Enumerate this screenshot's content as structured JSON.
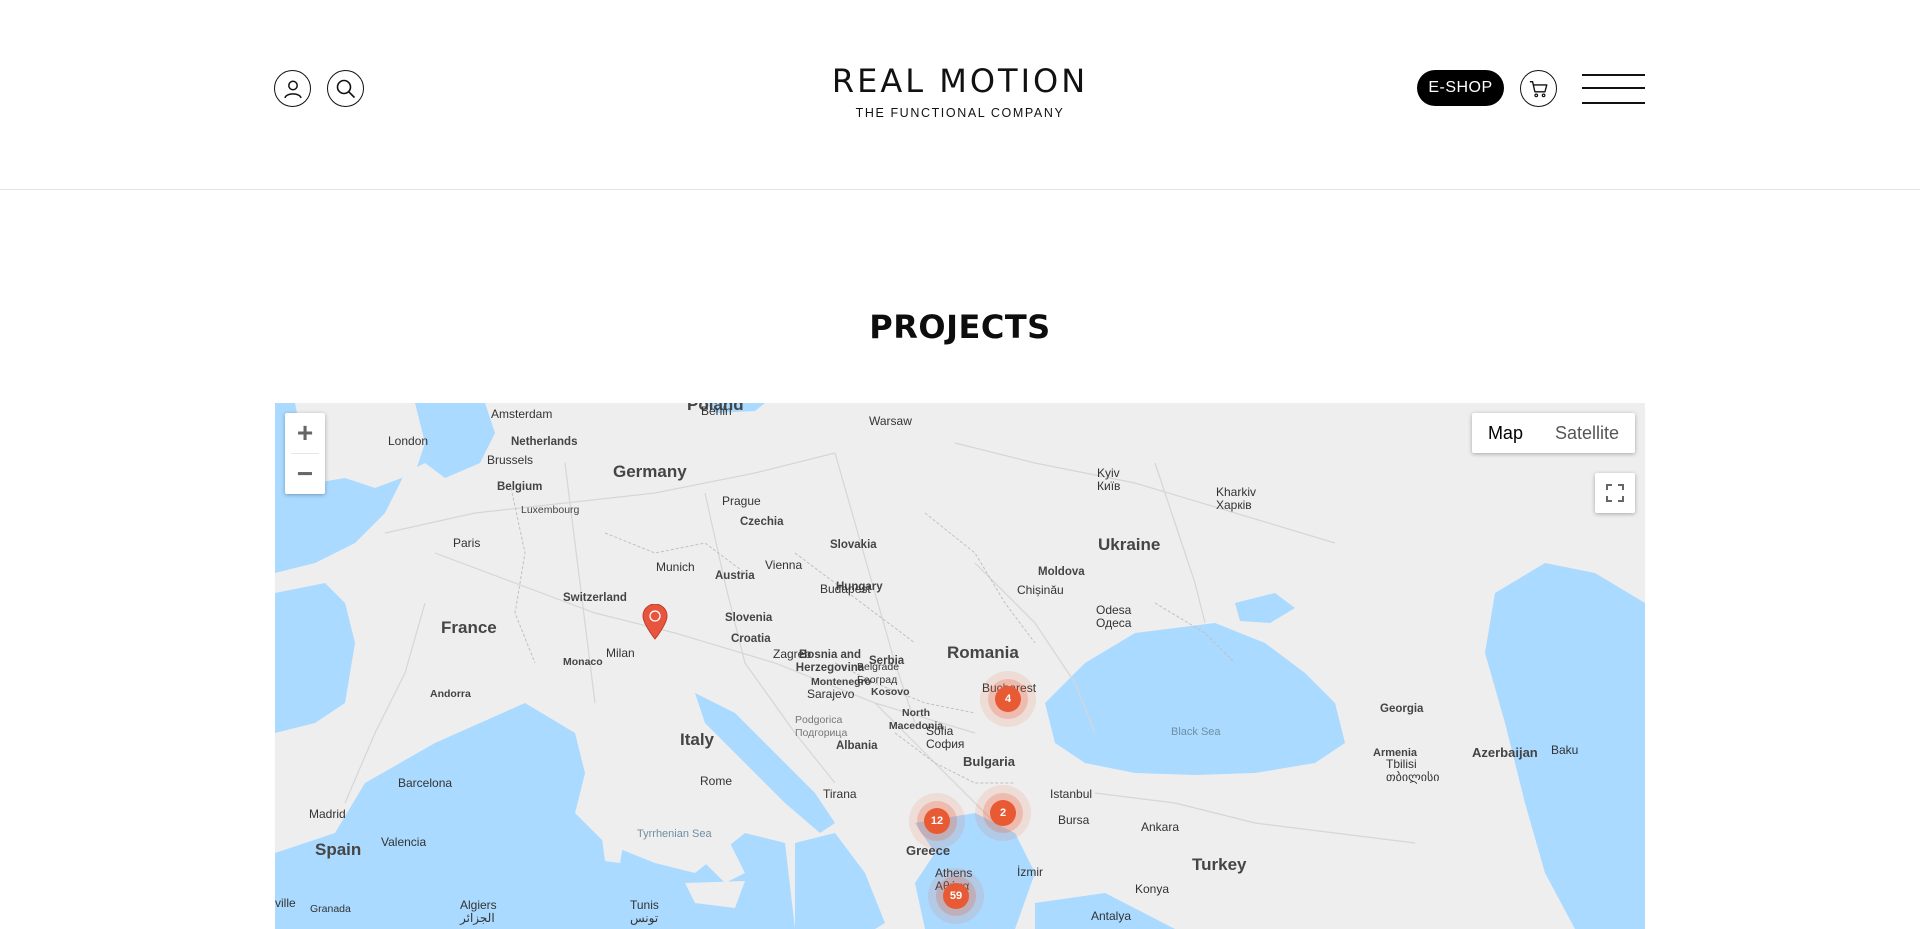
{
  "header": {
    "logo_main": "REAL MOTION",
    "logo_sub": "THE FUNCTIONAL COMPANY",
    "eshop_label": "E-SHOP"
  },
  "page": {
    "title": "PROJECTS"
  },
  "map": {
    "type_options": {
      "map": "Map",
      "satellite": "Satellite",
      "selected": "Map"
    },
    "zoom_in": "+",
    "zoom_out": "−",
    "clusters": [
      {
        "count": "4"
      },
      {
        "count": "12"
      },
      {
        "count": "2"
      },
      {
        "count": "59"
      }
    ],
    "countries": [
      "Poland",
      "Germany",
      "France",
      "Ukraine",
      "Romania",
      "Italy",
      "Spain",
      "Bulgaria",
      "Greece",
      "Turkey"
    ],
    "small_countries": [
      "Netherlands",
      "Belgium",
      "Luxembourg",
      "Czechia",
      "Slovakia",
      "Austria",
      "Hungary",
      "Moldova",
      "Switzerland",
      "Slovenia",
      "Croatia",
      "Bosnia and Herzegovina",
      "Serbia",
      "Monaco",
      "Andorra",
      "Montenegro",
      "Kosovo",
      "North Macedonia",
      "Albania",
      "Georgia",
      "Armenia",
      "Azerbaijan"
    ],
    "cities": [
      "Amsterdam",
      "London",
      "Brussels",
      "Berlin",
      "Warsaw",
      "Prague",
      "Paris",
      "Munich",
      "Vienna",
      "Budapest",
      "Kyiv Київ",
      "Kharkiv Харків",
      "Odesa Одеса",
      "Chișinău",
      "Milan",
      "Zagreb",
      "Belgrade Београд",
      "Bucharest",
      "Sarajevo",
      "Sofia София",
      "Podgorica Подгорица",
      "Rome",
      "Tirana",
      "Barcelona",
      "Madrid",
      "Valencia",
      "Istanbul",
      "Bursa",
      "Ankara",
      "İzmir",
      "Athens Αθήνα",
      "Tbilisi თბილისი",
      "Baku",
      "Konya",
      "Antalya",
      "Granada",
      "Algiers الجزائر",
      "Tunis تونس",
      "ville"
    ],
    "seas": [
      "Black Sea",
      "Tyrrhenian Sea"
    ]
  },
  "colors": {
    "accent": "#e85a34",
    "water": "#aadaff",
    "land": "#eeeeee",
    "eshop_bg": "#000000"
  },
  "icons": {
    "account": "user-icon",
    "search": "search-icon",
    "cart": "cart-icon",
    "menu": "hamburger-icon",
    "fullscreen": "fullscreen-icon",
    "location": "map-pin-icon"
  }
}
